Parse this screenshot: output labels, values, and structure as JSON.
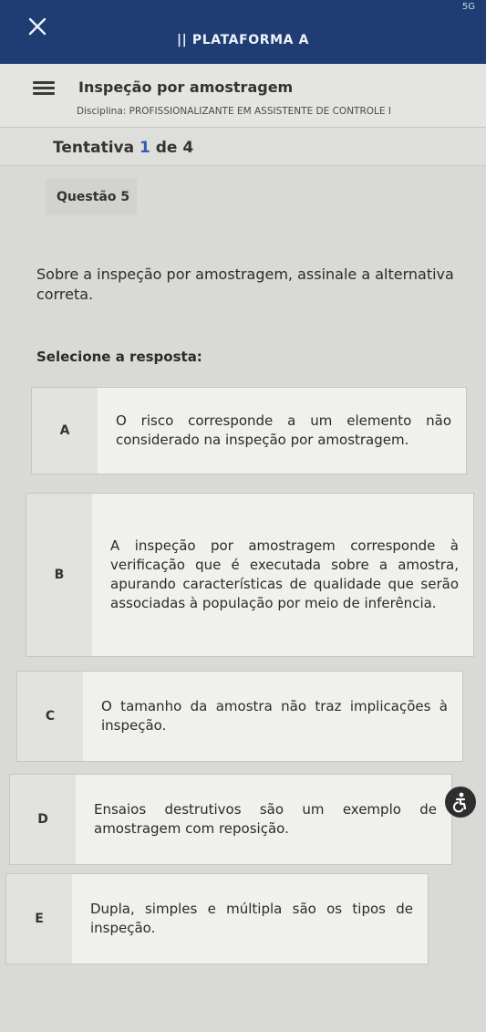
{
  "topbar": {
    "title": "|| PLATAFORMA A",
    "status": "5G"
  },
  "course": {
    "title": "Inspeção por amostragem",
    "discipline": "Disciplina: PROFISSIONALIZANTE EM ASSISTENTE DE CONTROLE I"
  },
  "attempt": {
    "prefix": "Tentativa",
    "current": "1",
    "suffix": "de 4"
  },
  "question": {
    "label": "Questão 5",
    "body": "Sobre a inspeção por amostragem, assinale a alternativa correta.",
    "select_label": "Selecione a resposta:"
  },
  "options": [
    {
      "letter": "A",
      "text": "O risco corresponde a um elemento não considerado na inspeção por amostragem."
    },
    {
      "letter": "B",
      "text": "A inspeção por amostragem corresponde à verificação que é executada sobre a amostra, apurando características de qualidade que serão associadas à população por meio de inferência."
    },
    {
      "letter": "C",
      "text": "O tamanho da amostra não traz implicações à inspeção."
    },
    {
      "letter": "D",
      "text": "Ensaios destrutivos são um exemplo de amostragem com reposição."
    },
    {
      "letter": "E",
      "text": "Dupla, simples e múltipla são os tipos de inspeção."
    }
  ],
  "colors": {
    "header_bg": "#1f3d72",
    "accent": "#2f5fb0"
  },
  "icons": {
    "close": "close-icon",
    "menu": "hamburger-menu-icon",
    "accessibility": "accessibility-icon"
  }
}
